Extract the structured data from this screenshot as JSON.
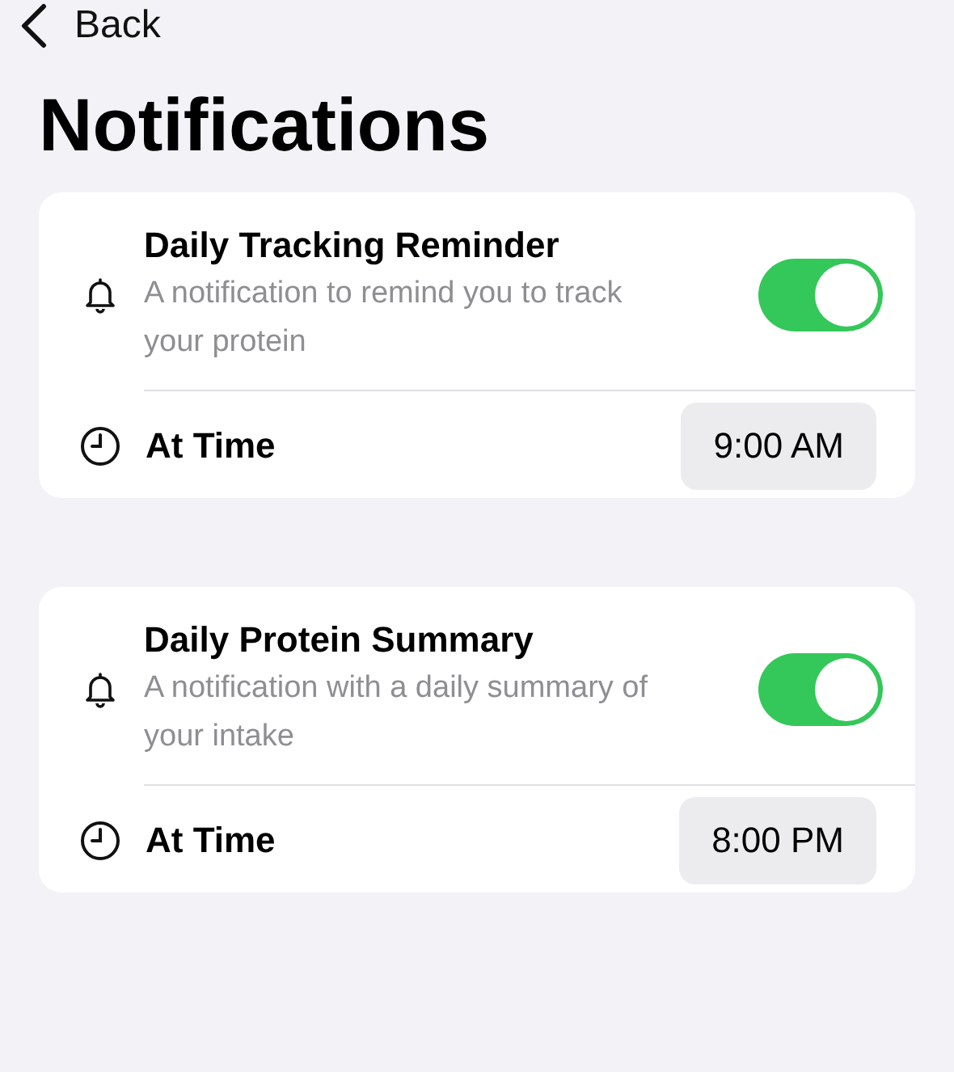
{
  "nav": {
    "back": "Back"
  },
  "title": "Notifications",
  "cards": [
    {
      "title": "Daily Tracking Reminder",
      "description": "A notification to remind you to track your protein",
      "on": true,
      "time_label": "At Time",
      "time": "9:00 AM"
    },
    {
      "title": "Daily Protein Summary",
      "description": "A notification with a daily summary of your intake",
      "on": true,
      "time_label": "At Time",
      "time": "8:00 PM"
    }
  ]
}
